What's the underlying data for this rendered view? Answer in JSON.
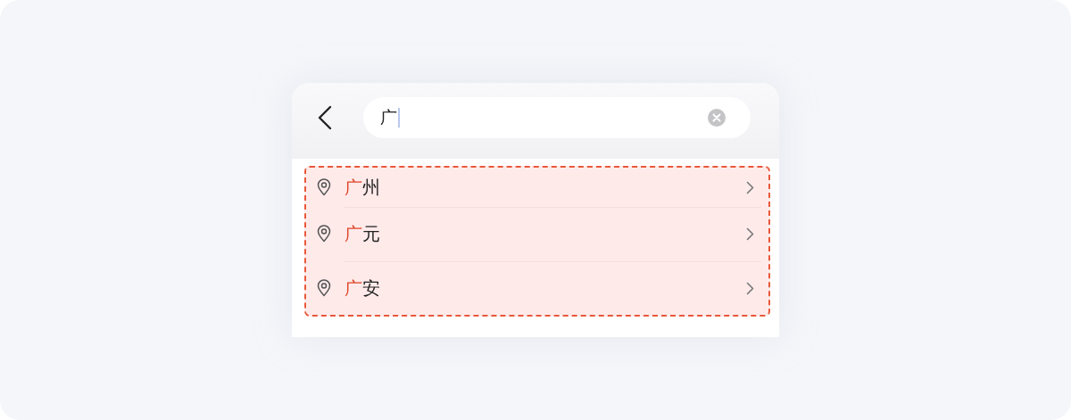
{
  "search": {
    "value": "广"
  },
  "suggestions": [
    {
      "highlight": "广",
      "text": "州"
    },
    {
      "highlight": "广",
      "text": "元"
    },
    {
      "highlight": "广",
      "text": "安"
    }
  ]
}
